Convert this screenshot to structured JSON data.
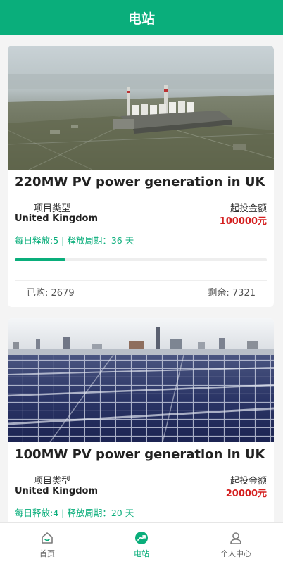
{
  "header": {
    "title": "电站"
  },
  "projects": [
    {
      "title": "220MW PV power generation in UK",
      "type_label": "项目类型",
      "type_value": "United Kingdom",
      "amount_label": "起投金额",
      "amount_value": "100000元",
      "release_info": "每日释放:5 | 释放周期：36 天",
      "progress": 0.2,
      "bought": "已购: 2679",
      "remaining": "剩余: 7321"
    },
    {
      "title": "100MW PV power generation in UK",
      "type_label": "项目类型",
      "type_value": "United Kingdom",
      "amount_label": "起投金额",
      "amount_value": "20000元",
      "release_info": "每日释放:4 | 释放周期：20 天"
    }
  ],
  "tabbar": {
    "items": [
      {
        "label": "首页",
        "icon": "home-icon",
        "active": false
      },
      {
        "label": "电站",
        "icon": "power-station-icon",
        "active": true
      },
      {
        "label": "个人中心",
        "icon": "user-icon",
        "active": false
      }
    ]
  },
  "colors": {
    "brand": "#0aae7b",
    "price": "#d41f1f"
  }
}
